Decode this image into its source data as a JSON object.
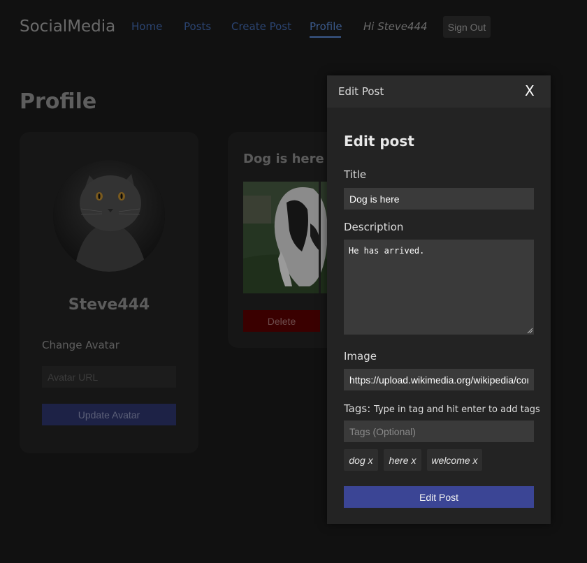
{
  "navbar": {
    "brand": "SocialMedia",
    "links": [
      "Home",
      "Posts",
      "Create Post",
      "Profile"
    ],
    "greeting": "Hi Steve444",
    "signout_label": "Sign Out"
  },
  "page": {
    "title": "Profile"
  },
  "profile_card": {
    "username": "Steve444",
    "change_avatar_label": "Change Avatar",
    "avatar_placeholder": "Avatar URL",
    "update_avatar_label": "Update Avatar"
  },
  "post_card": {
    "title": "Dog is here",
    "delete_label": "Delete"
  },
  "modal": {
    "header_title": "Edit Post",
    "close_label": "X",
    "heading": "Edit post",
    "title_label": "Title",
    "title_value": "Dog is here",
    "description_label": "Description",
    "description_value": "He has arrived.",
    "image_label": "Image",
    "image_value": "https://upload.wikimedia.org/wikipedia/comm",
    "tags_label": "Tags:",
    "tags_hint": "Type in tag and hit enter to add tags",
    "tags_placeholder": "Tags (Optional)",
    "tags": [
      "dog x",
      "here x",
      "welcome x"
    ],
    "submit_label": "Edit Post"
  },
  "colors": {
    "background": "#111111",
    "modal_background": "#232323",
    "accent_button": "#3b4595",
    "delete_button": "#3a0000",
    "nav_link": "#2b4471"
  }
}
